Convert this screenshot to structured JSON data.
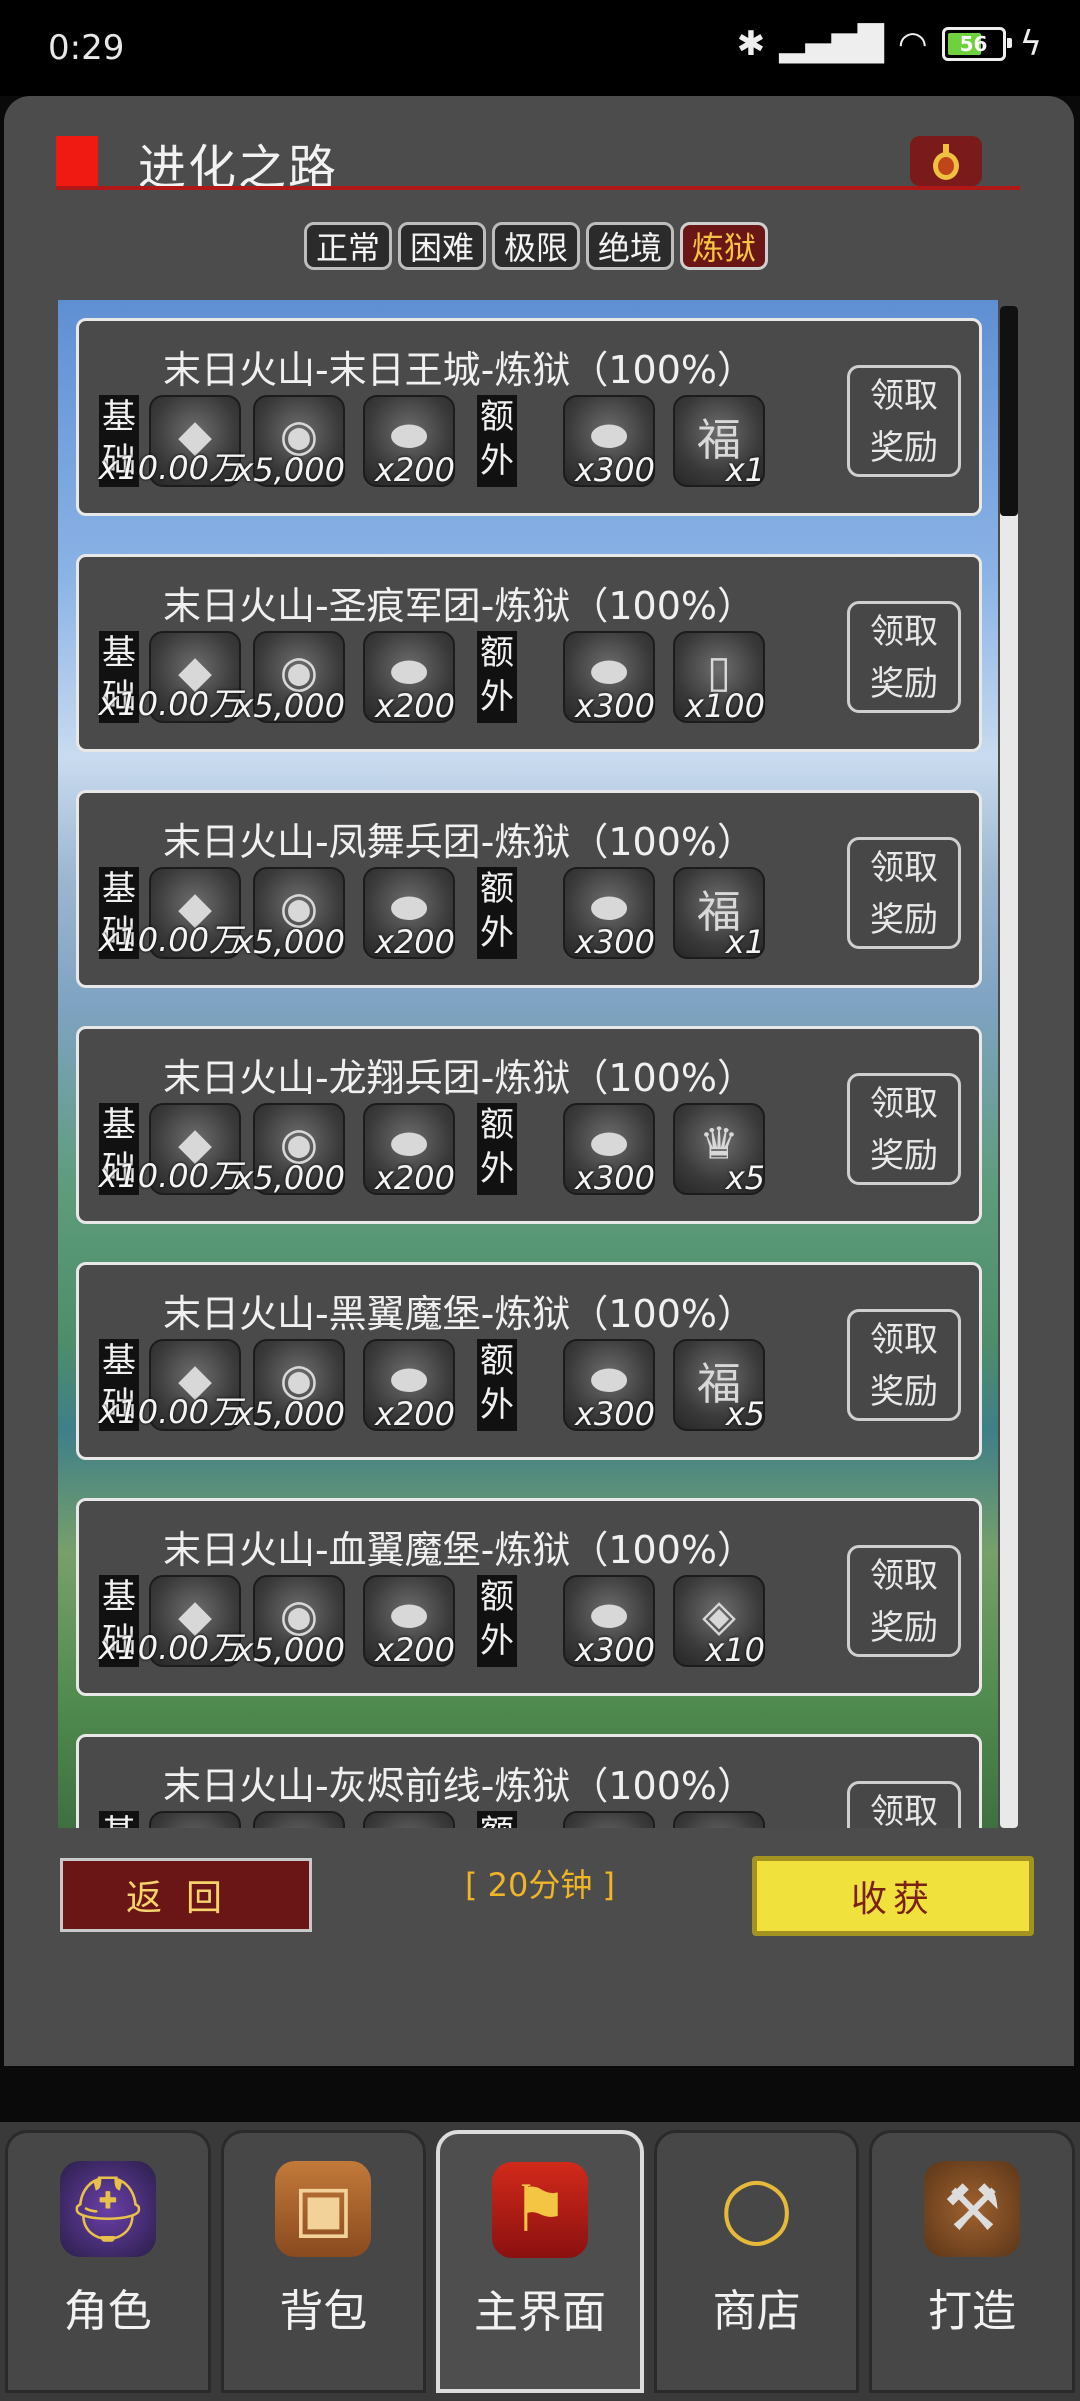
{
  "status": {
    "time": "0:29",
    "battery": "56"
  },
  "header": {
    "title": "进化之路"
  },
  "tabs": [
    {
      "label": "正常",
      "active": false
    },
    {
      "label": "困难",
      "active": false
    },
    {
      "label": "极限",
      "active": false
    },
    {
      "label": "绝境",
      "active": false
    },
    {
      "label": "炼狱",
      "active": true
    }
  ],
  "labels": {
    "base": "基础",
    "extra": "额外",
    "claim_line1": "领取",
    "claim_line2": "奖励"
  },
  "entries": [
    {
      "title": "末日火山-末日王城-炼狱（100%）",
      "base": [
        {
          "icon": "diamond-icon",
          "qty": "x10.00万"
        },
        {
          "icon": "orb-icon",
          "qty": "x5,000"
        },
        {
          "icon": "stone-icon",
          "qty": "x200"
        }
      ],
      "extra": [
        {
          "icon": "stone-icon",
          "qty": "x300"
        },
        {
          "icon": "lucky-bag-icon",
          "qty": "x1"
        }
      ]
    },
    {
      "title": "末日火山-圣痕军团-炼狱（100%）",
      "base": [
        {
          "icon": "diamond-icon",
          "qty": "x10.00万"
        },
        {
          "icon": "orb-icon",
          "qty": "x5,000"
        },
        {
          "icon": "stone-icon",
          "qty": "x200"
        }
      ],
      "extra": [
        {
          "icon": "stone-icon",
          "qty": "x300"
        },
        {
          "icon": "ticket-icon",
          "qty": "x100"
        }
      ]
    },
    {
      "title": "末日火山-凤舞兵团-炼狱（100%）",
      "base": [
        {
          "icon": "diamond-icon",
          "qty": "x10.00万"
        },
        {
          "icon": "orb-icon",
          "qty": "x5,000"
        },
        {
          "icon": "stone-icon",
          "qty": "x200"
        }
      ],
      "extra": [
        {
          "icon": "stone-icon",
          "qty": "x300"
        },
        {
          "icon": "lucky-bag-icon",
          "qty": "x1"
        }
      ]
    },
    {
      "title": "末日火山-龙翔兵团-炼狱（100%）",
      "base": [
        {
          "icon": "diamond-icon",
          "qty": "x10.00万"
        },
        {
          "icon": "orb-icon",
          "qty": "x5,000"
        },
        {
          "icon": "stone-icon",
          "qty": "x200"
        }
      ],
      "extra": [
        {
          "icon": "stone-icon",
          "qty": "x300"
        },
        {
          "icon": "crown-gem-icon",
          "qty": "x5"
        }
      ]
    },
    {
      "title": "末日火山-黑翼魔堡-炼狱（100%）",
      "base": [
        {
          "icon": "diamond-icon",
          "qty": "x10.00万"
        },
        {
          "icon": "orb-icon",
          "qty": "x5,000"
        },
        {
          "icon": "stone-icon",
          "qty": "x200"
        }
      ],
      "extra": [
        {
          "icon": "stone-icon",
          "qty": "x300"
        },
        {
          "icon": "lucky-bag-icon",
          "qty": "x5"
        }
      ]
    },
    {
      "title": "末日火山-血翼魔堡-炼狱（100%）",
      "base": [
        {
          "icon": "diamond-icon",
          "qty": "x10.00万"
        },
        {
          "icon": "orb-icon",
          "qty": "x5,000"
        },
        {
          "icon": "stone-icon",
          "qty": "x200"
        }
      ],
      "extra": [
        {
          "icon": "stone-icon",
          "qty": "x300"
        },
        {
          "icon": "crystal-icon",
          "qty": "x10"
        }
      ]
    },
    {
      "title": "末日火山-灰烬前线-炼狱（100%）",
      "base": [
        {
          "icon": "diamond-icon",
          "qty": ""
        },
        {
          "icon": "orb-icon",
          "qty": ""
        },
        {
          "icon": "stone-icon",
          "qty": ""
        }
      ],
      "extra": [
        {
          "icon": "stone-icon",
          "qty": ""
        },
        {
          "icon": "lucky-bag-icon",
          "qty": ""
        }
      ]
    }
  ],
  "footer": {
    "back_label": "返回",
    "timer": "[ 20分钟 ]",
    "harvest_label": "收获"
  },
  "nav": [
    {
      "label": "角色",
      "icon": "helmet-icon",
      "active": false
    },
    {
      "label": "背包",
      "icon": "chest-icon",
      "active": false
    },
    {
      "label": "主界面",
      "icon": "banner-icon",
      "active": true
    },
    {
      "label": "商店",
      "icon": "necklace-icon",
      "active": false
    },
    {
      "label": "打造",
      "icon": "forge-bag-icon",
      "active": false
    }
  ]
}
